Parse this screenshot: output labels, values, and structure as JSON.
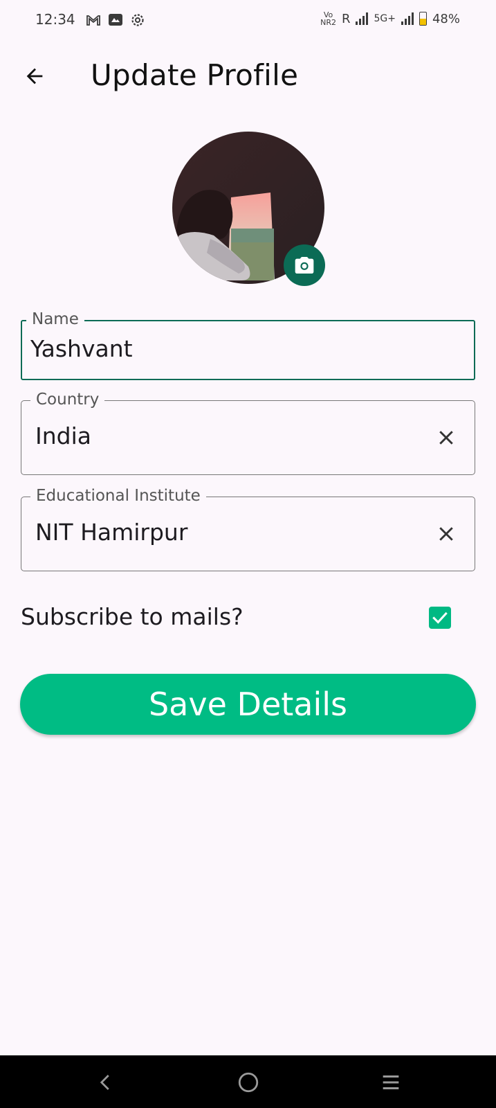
{
  "status_bar": {
    "time": "12:34",
    "left_icons": [
      "gmail-icon",
      "message-icon",
      "settings-icon"
    ],
    "volte_top": "Vo",
    "volte_bottom": "NR2",
    "roaming": "R",
    "network": "5G+",
    "battery": "48%",
    "battery_level": 0.48
  },
  "app_bar": {
    "title": "Update Profile",
    "back_icon": "arrow-back-icon"
  },
  "profile": {
    "avatar_icon": "profile-photo",
    "edit_photo_icon": "camera-icon"
  },
  "form": {
    "name": {
      "label": "Name",
      "value": "Yashvant"
    },
    "country": {
      "label": "Country",
      "value": "India",
      "clear_icon": "close-icon"
    },
    "institute": {
      "label": "Educational Institute",
      "value": "NIT Hamirpur",
      "clear_icon": "close-icon"
    },
    "subscribe": {
      "label": "Subscribe to mails?",
      "checked": true
    }
  },
  "save_button": {
    "label": "Save Details"
  },
  "colors": {
    "background": "#fcf7fc",
    "accent": "#00bc84",
    "focus": "#0b6b55",
    "checkbox": "#00b983"
  },
  "nav_bar": {
    "back_icon": "nav-back-icon",
    "home_icon": "nav-home-icon",
    "menu_icon": "nav-menu-icon"
  }
}
